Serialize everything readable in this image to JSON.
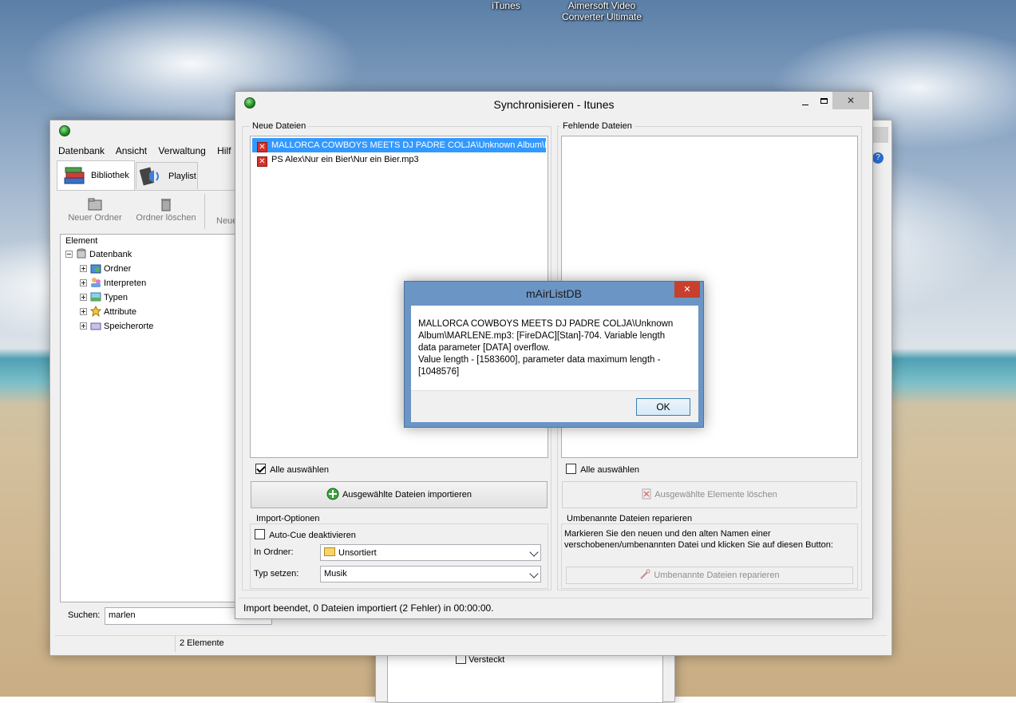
{
  "desktop": {
    "icons": [
      {
        "label": "iTunes"
      },
      {
        "label": "Aimersoft Video Converter Ultimate"
      }
    ]
  },
  "main_window": {
    "menu": [
      "Datenbank",
      "Ansicht",
      "Verwaltung",
      "Hilf"
    ],
    "tabs": [
      {
        "label": "Bibliothek",
        "active": true
      },
      {
        "label": "Playlist",
        "active": false
      }
    ],
    "toolbar": {
      "new_folder": "Neuer Ordner",
      "delete_folder": "Ordner löschen",
      "new_partial": "Neue"
    },
    "tree": {
      "header": "Element",
      "root": "Datenbank",
      "children": [
        "Ordner",
        "Interpreten",
        "Typen",
        "Attribute",
        "Speicherorte"
      ]
    },
    "search": {
      "label": "Suchen:",
      "value": "marlen"
    },
    "status": "2 Elemente",
    "background_checkbox_label": "Versteckt"
  },
  "sync_window": {
    "title": "Synchronisieren - Itunes",
    "new_files": {
      "group_title": "Neue Dateien",
      "items": [
        {
          "text": "MALLORCA COWBOYS MEETS DJ PADRE  COLJA\\Unknown Album\\M...",
          "selected": true
        },
        {
          "text": "PS Alex\\Nur ein Bier\\Nur ein Bier.mp3",
          "selected": false
        }
      ],
      "select_all": "Alle auswählen",
      "select_all_checked": true,
      "import_button": "Ausgewählte Dateien importieren"
    },
    "missing_files": {
      "group_title": "Fehlende Dateien",
      "select_all": "Alle auswählen",
      "select_all_checked": false,
      "delete_button": "Ausgewählte Elemente löschen"
    },
    "import_options": {
      "group_title": "Import-Optionen",
      "auto_cue": "Auto-Cue deaktivieren",
      "folder_label": "In Ordner:",
      "folder_value": "Unsortiert",
      "type_label": "Typ setzen:",
      "type_value": "Musik"
    },
    "repair": {
      "group_title": "Umbenannte Dateien reparieren",
      "description": "Markieren Sie den neuen und den alten Namen einer verschobenen/umbenannten Datei und klicken Sie auf diesen Button:",
      "button": "Umbenannte Dateien reparieren"
    },
    "status": "Import beendet, 0 Dateien importiert (2 Fehler) in 00:00:00."
  },
  "dialog": {
    "title": "mAirListDB",
    "message_line1": "MALLORCA COWBOYS MEETS DJ PADRE  COLJA\\Unknown Album\\MARLENE.mp3: [FireDAC][Stan]-704. Variable length data parameter [DATA] overflow.",
    "message_line2": "Value length - [1583600], parameter data maximum length - [1048576]",
    "ok": "OK",
    "close": "✕"
  },
  "colors": {
    "dialog_frame": "#6b95c4",
    "close_red": "#c7402e",
    "selection": "#3399ff"
  }
}
